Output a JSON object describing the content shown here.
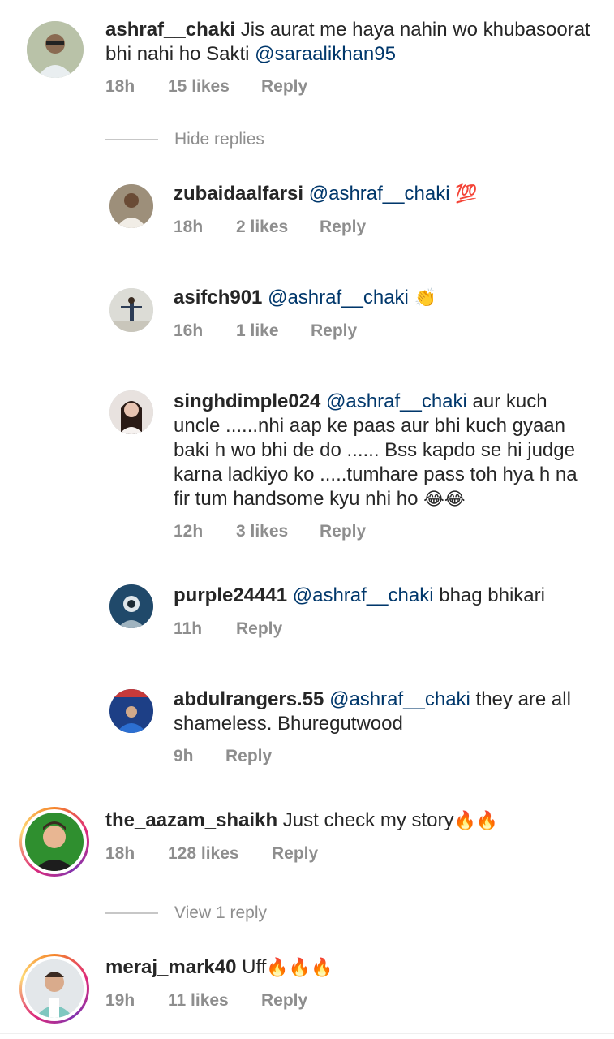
{
  "comments": [
    {
      "username": "ashraf__chaki",
      "text": "Jis aurat me haya nahin wo khubasoorat bhi nahi ho Sakti ",
      "mention": "@saraalikhan95",
      "time": "18h",
      "likes": "15 likes",
      "reply": "Reply"
    },
    {
      "username": "zubaidaalfarsi",
      "mention": "@ashraf__chaki",
      "emoji": "💯",
      "time": "18h",
      "likes": "2 likes",
      "reply": "Reply"
    },
    {
      "username": "asifch901",
      "mention": "@ashraf__chaki",
      "emoji": "👏",
      "time": "16h",
      "likes": "1 like",
      "reply": "Reply"
    },
    {
      "username": "singhdimple024",
      "mention": "@ashraf__chaki",
      "text": " aur kuch uncle ......nhi aap ke paas aur bhi kuch gyaan baki h wo bhi de do ...... Bss kapdo se hi judge karna ladkiyo ko .....tumhare pass toh hya h na fir tum handsome kyu nhi ho ",
      "emoji": "😂😂",
      "time": "12h",
      "likes": "3 likes",
      "reply": "Reply"
    },
    {
      "username": "purple24441",
      "mention": "@ashraf__chaki",
      "text": " bhag bhikari",
      "time": "11h",
      "reply": "Reply"
    },
    {
      "username": "abdulrangers.55",
      "mention": "@ashraf__chaki",
      "text": " they are all shameless. Bhuregutwood",
      "time": "9h",
      "reply": "Reply"
    },
    {
      "username": "the_aazam_shaikh",
      "text": "Just check my story",
      "emoji": "🔥🔥",
      "time": "18h",
      "likes": "128 likes",
      "reply": "Reply"
    },
    {
      "username": "meraj_mark40",
      "text": "Uff",
      "emoji": "🔥🔥🔥",
      "time": "19h",
      "likes": "11 likes",
      "reply": "Reply"
    }
  ],
  "toggles": {
    "hide_replies": "Hide replies",
    "view_reply": "View 1 reply"
  },
  "colors": {
    "mention": "#00376b",
    "meta": "#8e8e8e",
    "text": "#262626"
  }
}
